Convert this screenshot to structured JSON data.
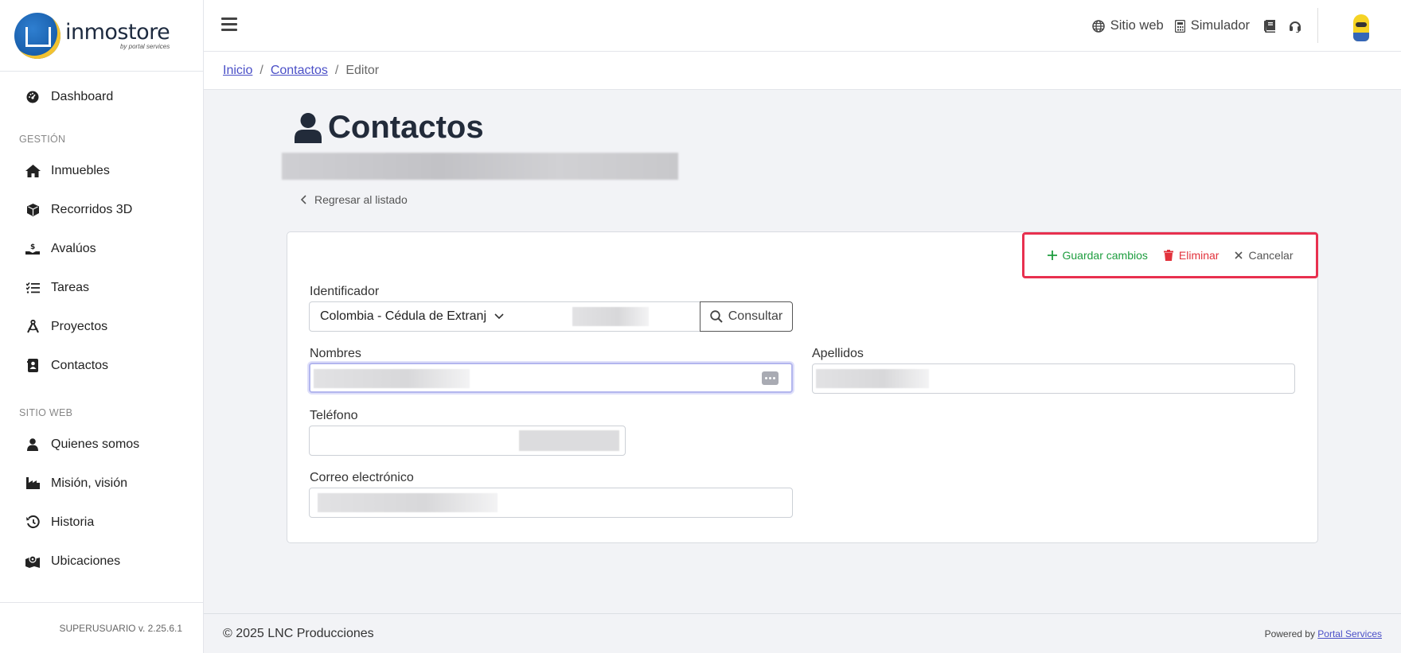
{
  "app": {
    "logo_name": "inmostore",
    "logo_sub": "by portal services"
  },
  "sidebar": {
    "items_top": [
      {
        "label": "Dashboard",
        "icon": "dashboard-icon"
      }
    ],
    "section_gestion": "GESTIÓN",
    "items_gestion": [
      {
        "label": "Inmuebles",
        "icon": "home-icon"
      },
      {
        "label": "Recorridos 3D",
        "icon": "cube-icon"
      },
      {
        "label": "Avalúos",
        "icon": "hand-dollar-icon"
      },
      {
        "label": "Tareas",
        "icon": "checklist-icon"
      },
      {
        "label": "Proyectos",
        "icon": "compass-icon"
      },
      {
        "label": "Contactos",
        "icon": "address-book-icon"
      }
    ],
    "section_sitio": "SITIO WEB",
    "items_sitio": [
      {
        "label": "Quienes somos",
        "icon": "user-icon"
      },
      {
        "label": "Misión, visión",
        "icon": "industry-icon"
      },
      {
        "label": "Historia",
        "icon": "history-icon"
      },
      {
        "label": "Ubicaciones",
        "icon": "map-pin-icon"
      }
    ],
    "version": "SUPERUSUARIO v. 2.25.6.1"
  },
  "topbar": {
    "sitio_web": "Sitio web",
    "simulador": "Simulador"
  },
  "breadcrumb": {
    "inicio": "Inicio",
    "contactos": "Contactos",
    "editor": "Editor"
  },
  "page": {
    "title": "Contactos",
    "back": "Regresar al listado"
  },
  "actions": {
    "save": "Guardar cambios",
    "delete": "Eliminar",
    "cancel": "Cancelar"
  },
  "form": {
    "identificador_label": "Identificador",
    "id_type": "Colombia - Cédula de Extranjería",
    "consultar": "Consultar",
    "nombres_label": "Nombres",
    "apellidos_label": "Apellidos",
    "telefono_label": "Teléfono",
    "correo_label": "Correo electrónico"
  },
  "footer": {
    "copyright": "© 2025 LNC Producciones",
    "powered_by": "Powered by",
    "powered_link": "Portal Services"
  },
  "colors": {
    "save": "#1e9d3f",
    "delete": "#e2323c",
    "highlight": "#e8304f",
    "link": "#4a4fc7"
  }
}
